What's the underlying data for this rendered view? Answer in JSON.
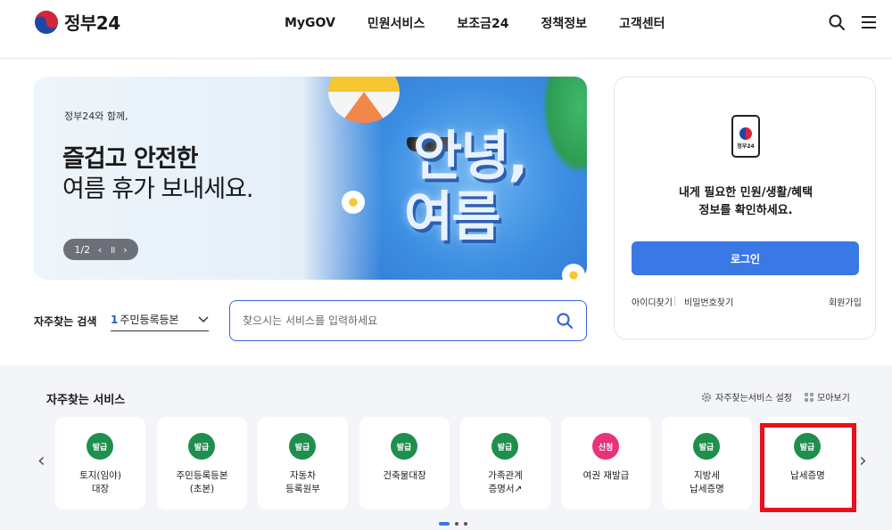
{
  "header": {
    "logo_text": "정부24",
    "nav": [
      "MyGOV",
      "민원서비스",
      "보조금24",
      "정책정보",
      "고객센터"
    ],
    "icons": [
      "search-icon",
      "menu-icon"
    ]
  },
  "banner": {
    "subtitle": "정부24와 함께,",
    "title_line1": "즐겁고 안전한",
    "title_line2": "여름 휴가 보내세요.",
    "big_text_line1": "안녕,",
    "big_text_line2": "여름",
    "pager": {
      "current": "1/2",
      "prev": "‹",
      "pause": "॥",
      "next": "›"
    }
  },
  "search": {
    "label": "자주찾는 검색",
    "select_num": "1",
    "select_value": "주민등록등본",
    "placeholder": "찾으시는 서비스를 입력하세요"
  },
  "login": {
    "device_label": "정부24",
    "message_line1": "내게 필요한 민원/생활/혜택",
    "message_line2": "정보를 확인하세요.",
    "button": "로그인",
    "find_id": "아이디찾기",
    "find_pw": "비밀번호찾기",
    "signup": "회원가입"
  },
  "frequent": {
    "title": "자주찾는 서비스",
    "setting_label": "자주찾는서비스 설정",
    "view_all_label": "모아보기",
    "cards": [
      {
        "badge": "발급",
        "label": "토지(임야)\n대장",
        "badge_color": "#1f8f4e"
      },
      {
        "badge": "발급",
        "label": "주민등록등본\n(초본)",
        "badge_color": "#1f8f4e"
      },
      {
        "badge": "발급",
        "label": "자동차\n등록원부",
        "badge_color": "#1f8f4e"
      },
      {
        "badge": "발급",
        "label": "건축물대장",
        "badge_color": "#1f8f4e"
      },
      {
        "badge": "발급",
        "label": "가족관계\n증명서↗",
        "badge_color": "#1f8f4e"
      },
      {
        "badge": "신청",
        "label": "여권 재발급",
        "badge_color": "#e8337a"
      },
      {
        "badge": "발급",
        "label": "지방세\n납세증명",
        "badge_color": "#1f8f4e"
      },
      {
        "badge": "발급",
        "label": "납세증명",
        "badge_color": "#1f8f4e"
      }
    ]
  },
  "colors": {
    "primary_blue": "#3a78e6",
    "search_border": "#3e63d8",
    "highlight_red": "#e8101a",
    "section_bg": "#f3f5f9"
  }
}
